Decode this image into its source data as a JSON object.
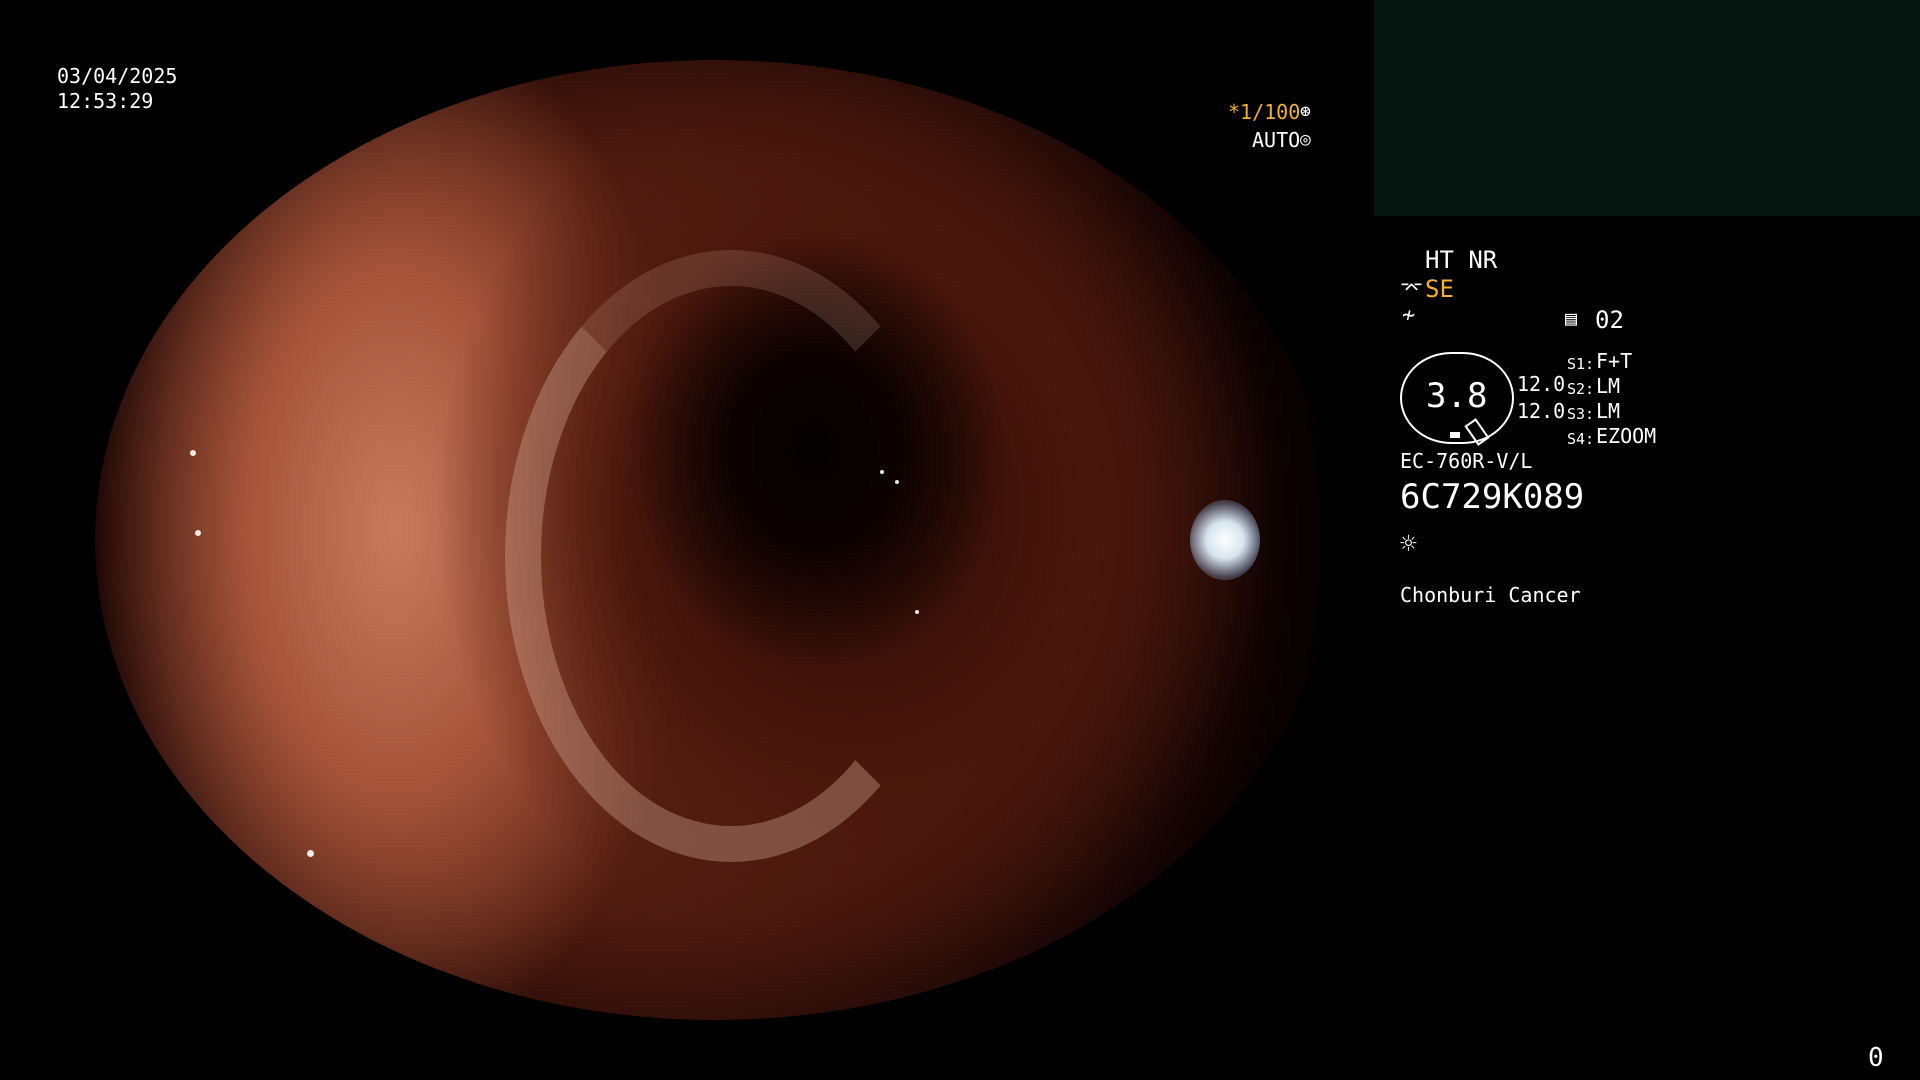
{
  "datetime": {
    "date": "03/04/2025",
    "time": "12:53:29"
  },
  "exposure": {
    "shutter": "*1/100",
    "shutter_icon": "aperture-icon",
    "mode": "AUTO",
    "mode_icon": "iris-icon"
  },
  "image_settings": {
    "ht_nr": "HT NR",
    "se": "SE",
    "se_icon": "structure-enhance-icon",
    "color_icon": "color-tone-icon",
    "preset_icon": "memory-icon",
    "preset": "02"
  },
  "zoom": {
    "value": "3.8",
    "left_top": "12.0",
    "left_bottom": "12.0"
  },
  "switches": [
    {
      "key": "S1:",
      "value": "F+T"
    },
    {
      "key": "S2:",
      "value": "LM"
    },
    {
      "key": "S3:",
      "value": "LM"
    },
    {
      "key": "S4:",
      "value": "EZOOM"
    }
  ],
  "scope": {
    "model": "EC-760R-V/L",
    "serial": "6C729K089",
    "light_icon": "light-source-icon"
  },
  "institution": "Chonburi Cancer",
  "counter": "0",
  "colors": {
    "accent": "#f0b030",
    "panel": "#061510",
    "text": "#ffffff"
  }
}
